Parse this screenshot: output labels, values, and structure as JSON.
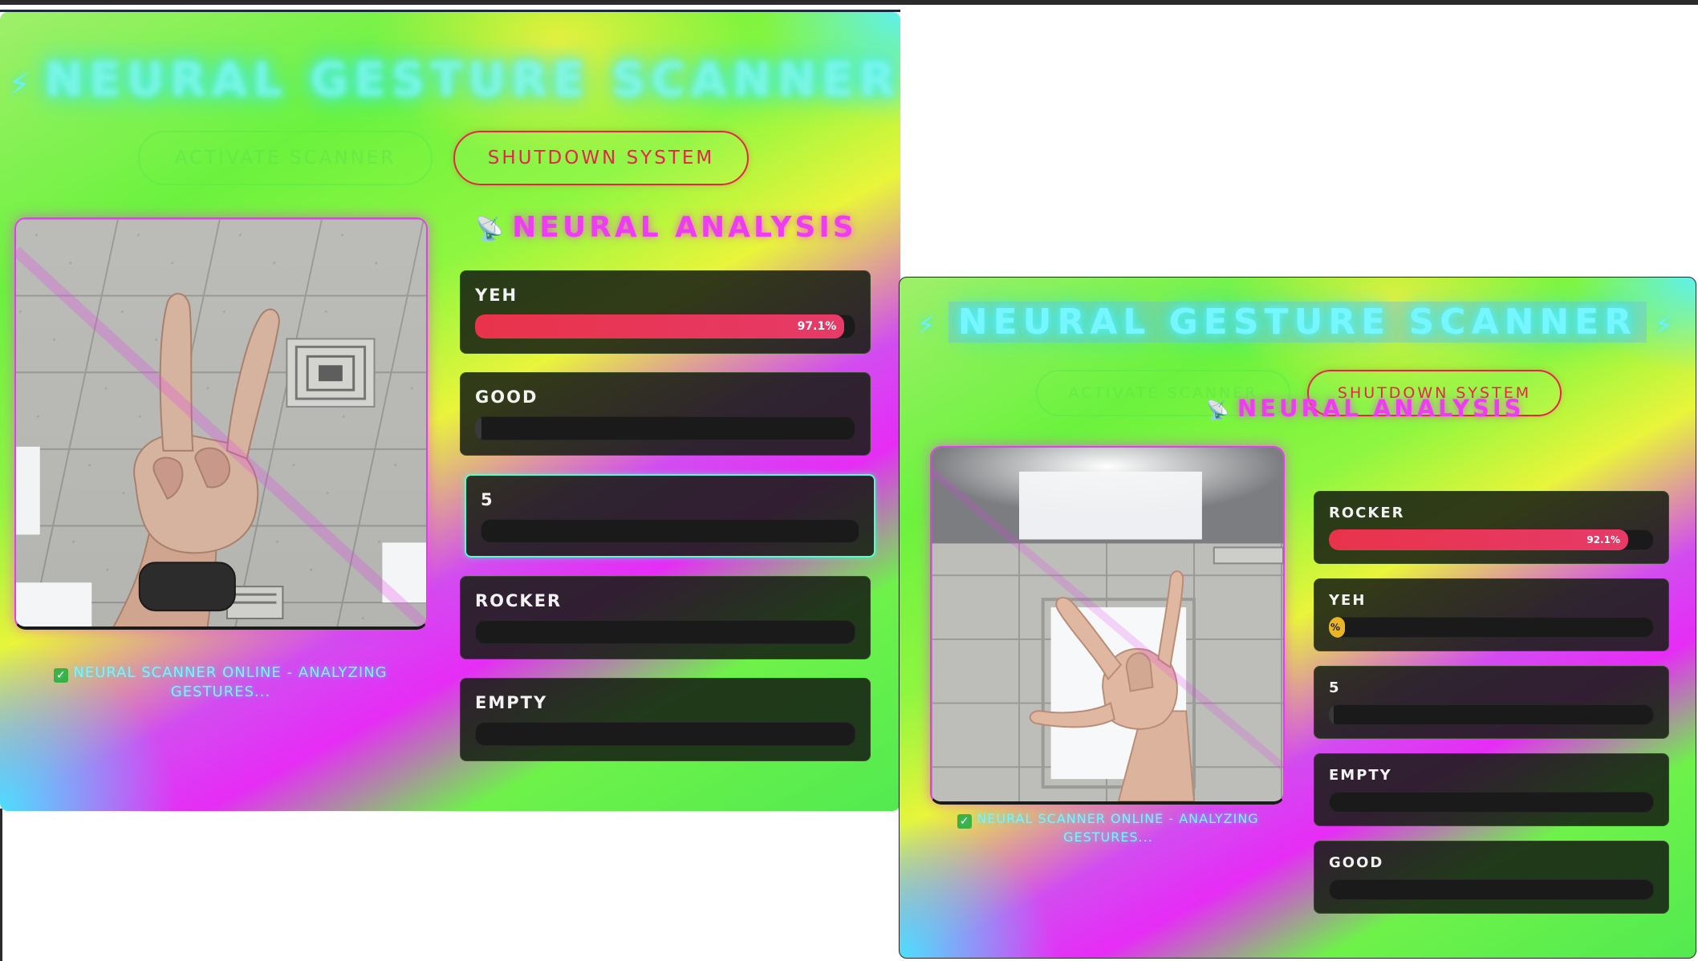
{
  "colors": {
    "title_glow": "#76f6ff",
    "analysis_title": "#ee3cf2",
    "shutdown": "#e5264a",
    "bar_fill": "#e8334a",
    "bar_fill_low": "#e9b425",
    "card_bg": "#141c12",
    "active_card_border": "#52ffd0",
    "status_text": "#7ff2ff"
  },
  "panels": [
    {
      "title": "NEURAL GESTURE SCANNER",
      "title_icon": "lightning-bolt-icon",
      "buttons": {
        "activate_label": "ACTIVATE SCANNER",
        "shutdown_label": "SHUTDOWN SYSTEM"
      },
      "analysis_title": "NEURAL ANALYSIS",
      "analysis_icon": "satellite-icon",
      "status": "NEURAL SCANNER ONLINE - ANALYZING GESTURES...",
      "status_icon": "checkbox-icon",
      "camera_gesture": "peace-sign",
      "gestures": [
        {
          "label": "YEH",
          "percent": 97.1,
          "percent_text": "97.1%",
          "active": false
        },
        {
          "label": "GOOD",
          "percent": 0.6,
          "percent_text": "",
          "active": false
        },
        {
          "label": "5",
          "percent": 0,
          "percent_text": "",
          "active": true
        },
        {
          "label": "ROCKER",
          "percent": 0,
          "percent_text": "",
          "active": false
        },
        {
          "label": "EMPTY",
          "percent": 0,
          "percent_text": "",
          "active": false
        }
      ]
    },
    {
      "title": "NEURAL GESTURE SCANNER",
      "title_icon": "lightning-bolt-icon",
      "buttons": {
        "activate_label": "ACTIVATE SCANNER",
        "shutdown_label": "SHUTDOWN SYSTEM"
      },
      "analysis_title": "NEURAL ANALYSIS",
      "analysis_icon": "satellite-icon",
      "status": "NEURAL SCANNER ONLINE - ANALYZING GESTURES...",
      "status_icon": "checkbox-icon",
      "camera_gesture": "rock-on-sign",
      "gestures": [
        {
          "label": "ROCKER",
          "percent": 92.1,
          "percent_text": "92.1%",
          "active": false
        },
        {
          "label": "YEH",
          "percent": 3.5,
          "percent_text": "%",
          "active": false
        },
        {
          "label": "5",
          "percent": 1.2,
          "percent_text": "",
          "active": false
        },
        {
          "label": "EMPTY",
          "percent": 0,
          "percent_text": "",
          "active": false
        },
        {
          "label": "GOOD",
          "percent": 0,
          "percent_text": "",
          "active": false
        }
      ]
    }
  ]
}
